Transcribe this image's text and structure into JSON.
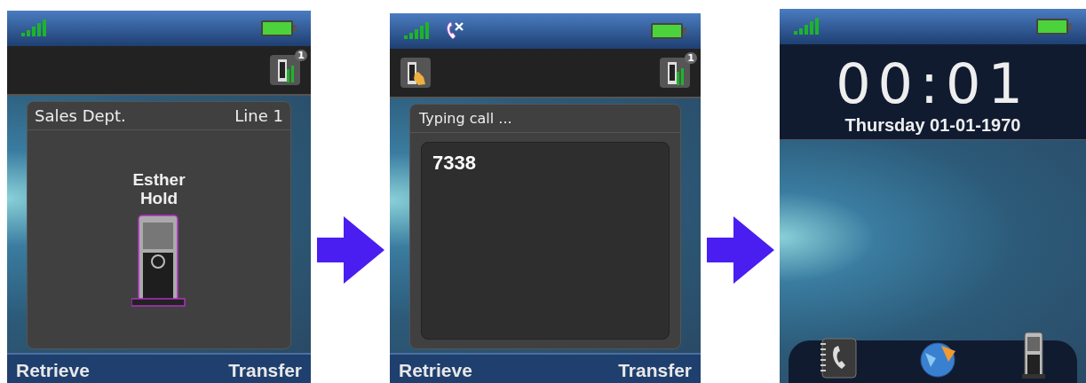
{
  "screens": [
    {
      "kind": "call",
      "missed_call": false,
      "call_badge": "1",
      "caller_id": "Sales Dept.",
      "line": "Line 1",
      "contact_name": "Esther",
      "call_state": "Hold",
      "soft_keys": [
        "Retrieve",
        "Transfer"
      ]
    },
    {
      "kind": "dialing",
      "missed_call": true,
      "call_badge": "1",
      "title": "Typing call ...",
      "number": "7338",
      "soft_keys": [
        "Retrieve",
        "Transfer"
      ]
    },
    {
      "kind": "idle",
      "missed_call": false,
      "time": "00:01",
      "date": "Thursday 01-01-1970"
    }
  ]
}
